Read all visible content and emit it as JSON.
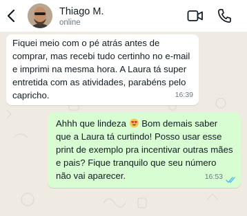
{
  "header": {
    "contact_name": "Thiago M.",
    "status": "online",
    "icons": {
      "back": "chevron-left-icon",
      "video": "video-camera-icon",
      "call": "phone-icon"
    }
  },
  "messages": [
    {
      "direction": "incoming",
      "text": "Fiquei meio com o pé atrás antes de comprar, mas recebi tudo certinho no e-mail e imprimi na mesma hora. A Laura tá super entretida com as atividades, parabéns pelo capricho.",
      "time": "16:39"
    },
    {
      "direction": "outgoing",
      "text_before_emoji": "Ahhh que lindeza ",
      "emoji": "heart-eyes-emoji",
      "text_after_emoji": " Bom demais saber que a Laura tá curtindo! Posso usar esse print de exemplo pra incentivar outras mães e pais? Fique tranquilo que seu número não vai aparecer.",
      "time": "16:53",
      "status_icon": "double-check-read-icon"
    }
  ],
  "colors": {
    "background": "#efeae2",
    "incoming_bubble": "#ffffff",
    "outgoing_bubble": "#d9fdd3",
    "read_ticks": "#53bdeb"
  }
}
